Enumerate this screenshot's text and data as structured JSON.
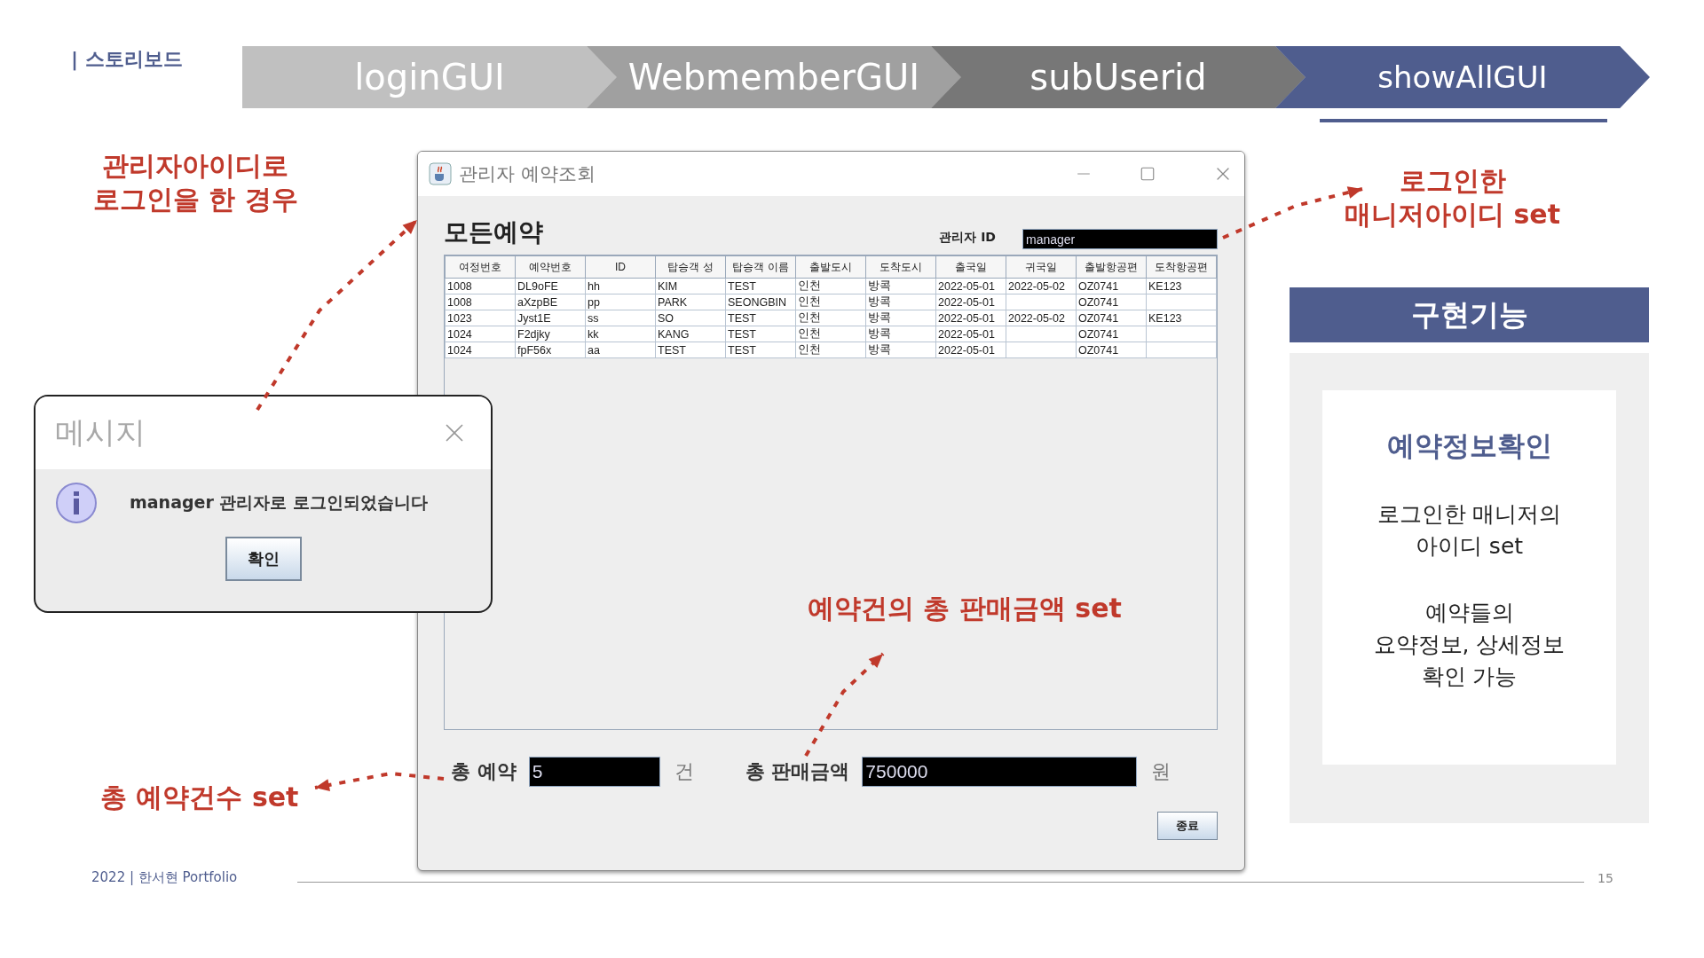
{
  "section_title": "| 스토리보드",
  "steps": [
    {
      "label": "loginGUI",
      "color": "#c0c0c0",
      "selected": false
    },
    {
      "label": "WebmemberGUI",
      "color": "#a0a0a0",
      "selected": false
    },
    {
      "label": "subUserid",
      "color": "#777777",
      "selected": false
    },
    {
      "label": "showAllGUI",
      "color": "#4f5d8e",
      "selected": true
    }
  ],
  "annotations": [
    {
      "text": "관리자아이디로\n로그인을 한 경우"
    },
    {
      "text": "로그인한\n매니저아이디 set"
    },
    {
      "text": "예약건의 총 판매금액 set"
    },
    {
      "text": "총 예약건수 set"
    }
  ],
  "main_window": {
    "title": "관리자 예약조회",
    "heading": "모든예약",
    "admin_label": "관리자 ID",
    "admin_value": "manager",
    "columns": [
      "여정번호",
      "예약번호",
      "ID",
      "탑승객 성",
      "탑승객 이름",
      "출발도시",
      "도착도시",
      "출국일",
      "귀국일",
      "출발항공편",
      "도착항공편"
    ],
    "rows": [
      [
        "1008",
        "DL9oFE",
        "hh",
        "KIM",
        "TEST",
        "인천",
        "방콕",
        "2022-05-01",
        "2022-05-02",
        "OZ0741",
        "KE123"
      ],
      [
        "1008",
        "aXzpBE",
        "pp",
        "PARK",
        "SEONGBIN",
        "인천",
        "방콕",
        "2022-05-01",
        "",
        "OZ0741",
        ""
      ],
      [
        "1023",
        "Jyst1E",
        "ss",
        "SO",
        "TEST",
        "인천",
        "방콕",
        "2022-05-01",
        "2022-05-02",
        "OZ0741",
        "KE123"
      ],
      [
        "1024",
        "F2djky",
        "kk",
        "KANG",
        "TEST",
        "인천",
        "방콕",
        "2022-05-01",
        "",
        "OZ0741",
        ""
      ],
      [
        "1024",
        "fpF56x",
        "aa",
        "TEST",
        "TEST",
        "인천",
        "방콕",
        "2022-05-01",
        "",
        "OZ0741",
        ""
      ]
    ],
    "count_label": "총 예약",
    "count_value": "5",
    "count_unit": "건",
    "sales_label": "총 판매금액",
    "sales_value": "750000",
    "sales_unit": "원",
    "close_button": "종료"
  },
  "dialog": {
    "title": "메시지",
    "message": "manager 관리자로 로그인되었습니다",
    "button": "확인"
  },
  "feature_panel": {
    "title": "구현기능",
    "item_title": "예약정보확인",
    "paragraphs": [
      "로그인한 매니저의\n아이디 set",
      "예약들의\n요약정보, 상세정보\n확인 가능"
    ]
  },
  "footer": {
    "text": "2022 | 한서현 Portfolio",
    "page": "15"
  }
}
